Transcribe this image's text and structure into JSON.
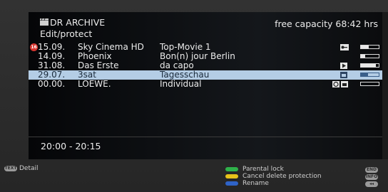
{
  "header": {
    "title": "DR ARCHIVE",
    "subtitle": "Edit/protect",
    "capacity": "free capacity 68:42 hrs",
    "icon": "clapperboard-icon"
  },
  "recordings": [
    {
      "date": "15.09.",
      "channel": "Sky Cinema HD",
      "title": "Top-Movie 1",
      "locked": true,
      "icons": [
        "key-icon"
      ],
      "progress": 0.45,
      "selected": false
    },
    {
      "date": "14.09.",
      "channel": "Phoenix",
      "title": "Bon(n) jour Berlin",
      "locked": false,
      "icons": [],
      "progress": 0.25,
      "selected": false
    },
    {
      "date": "31.08.",
      "channel": "Das Erste",
      "title": "da capo",
      "locked": false,
      "icons": [
        "play-icon"
      ],
      "progress": 0.85,
      "selected": false
    },
    {
      "date": "29.07.",
      "channel": "3sat",
      "title": "Tagesschau",
      "locked": false,
      "icons": [
        "protect-icon"
      ],
      "progress": 0.4,
      "selected": true
    },
    {
      "date": "00.00.",
      "channel": "LOEWE.",
      "title": "Individual",
      "locked": false,
      "icons": [
        "timer-icon",
        "protect-icon"
      ],
      "progress": 0,
      "selected": false
    }
  ],
  "time_range": "20:00 - 20:15",
  "footer": {
    "detail_key": "TEXT",
    "detail_label": "Detail",
    "legend": [
      {
        "color": "#2fb24a",
        "label": "Parental lock",
        "key": "END"
      },
      {
        "color": "#e8c21a",
        "label": "Cancel delete protection",
        "key": "INFO"
      },
      {
        "color": "#2f63c7",
        "label": "Rename",
        "key": "◂◂"
      }
    ]
  }
}
